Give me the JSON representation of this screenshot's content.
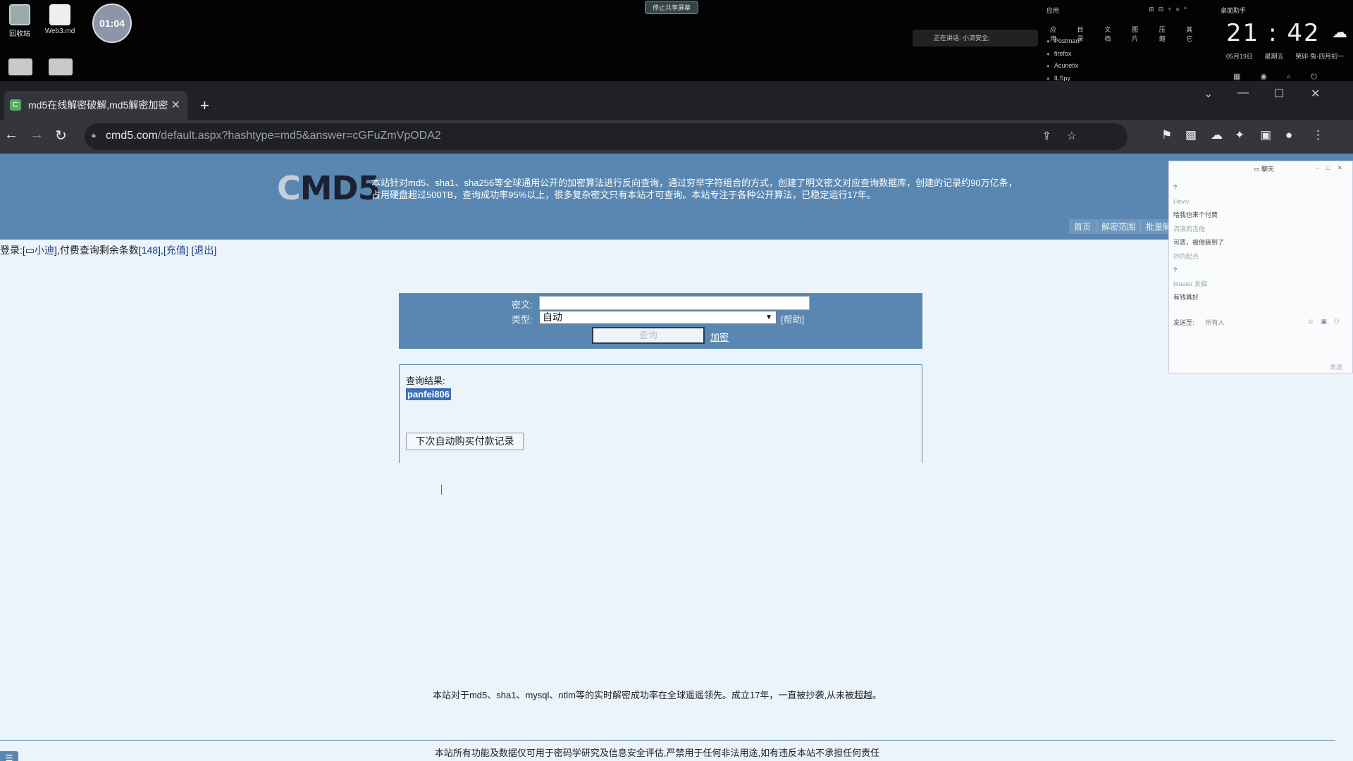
{
  "desktop": {
    "icons": [
      {
        "label": "回收站",
        "icon": "recycle-bin-icon"
      },
      {
        "label": "Web3.md",
        "icon": "document-icon"
      }
    ],
    "clock_widget": "01:04",
    "share_pill": "停止共享屏幕",
    "speaking": "正在讲话: 小流安全;",
    "launcher": {
      "header": "应用",
      "categories": [
        "应用",
        "目录",
        "文档",
        "图片",
        "压缩",
        "其它"
      ],
      "apps": [
        "Postman",
        "firefox",
        "Acunetix",
        "ILSpy"
      ]
    },
    "time_panel": {
      "label": "桌面助手",
      "time": "21 : 42",
      "date": "05月19日",
      "weekday": "星期五",
      "lunar": "癸卯·兔·四月初一"
    }
  },
  "browser": {
    "tab_title": "md5在线解密破解,md5解密加密",
    "url_host": "cmd5.com",
    "url_path": "/default.aspx?hashtype=md5&answer=cGFuZmVpODA2"
  },
  "site": {
    "logo": "MD5",
    "intro_line1": "本站针对md5、sha1、sha256等全球通用公开的加密算法进行反向查询，通过穷举字符组合的方式，创建了明文密文对应查询数据库，创建的记录约90万亿条，",
    "intro_line2": "占用硬盘超过500TB，查询成功率95%以上，很多复杂密文只有本站才可查询。本站专注于各种公开算法，已稳定运行17年。",
    "nav": [
      "首页",
      "解密范围",
      "批量解"
    ],
    "login_prefix": "登录:[",
    "login_user": "小迪",
    "login_mid": "],付费查询剩余条数[",
    "login_count": "148",
    "login_mid2": "],",
    "recharge": "[充值]",
    "logout": "[退出]"
  },
  "form": {
    "cipher_label": "密文:",
    "type_label": "类型:",
    "type_value": "自动",
    "help": "[帮助]",
    "query_button": "查询",
    "encrypt_link": "加密"
  },
  "result": {
    "label": "查询结果:",
    "value": "panfei806",
    "record_button": "下次自动购买付款记录"
  },
  "footer": {
    "line1": "本站对于md5、sha1、mysql、ntlm等的实时解密成功率在全球遥遥领先。成立17年，一直被抄袭,从未被超越。",
    "line2": "本站所有功能及数据仅可用于密码学研究及信息安全评估,严禁用于任何非法用途,如有违反本站不承担任何责任"
  },
  "chat": {
    "title": "聊天",
    "messages": [
      {
        "text": "?",
        "name": false
      },
      {
        "text": "Hoviv",
        "name": true
      },
      {
        "text": "哈我也来个付费",
        "name": false
      },
      {
        "text": "流浪的吉他",
        "name": true
      },
      {
        "text": "可恶，被他装到了",
        "name": false
      },
      {
        "text": "抄的起点",
        "name": true
      },
      {
        "text": "?",
        "name": false
      },
      {
        "text": "Master 发稿",
        "name": true
      },
      {
        "text": "有钱真好",
        "name": false
      }
    ],
    "send_to_label": "发送至:",
    "send_to_value": "所有人",
    "send": "发送"
  }
}
